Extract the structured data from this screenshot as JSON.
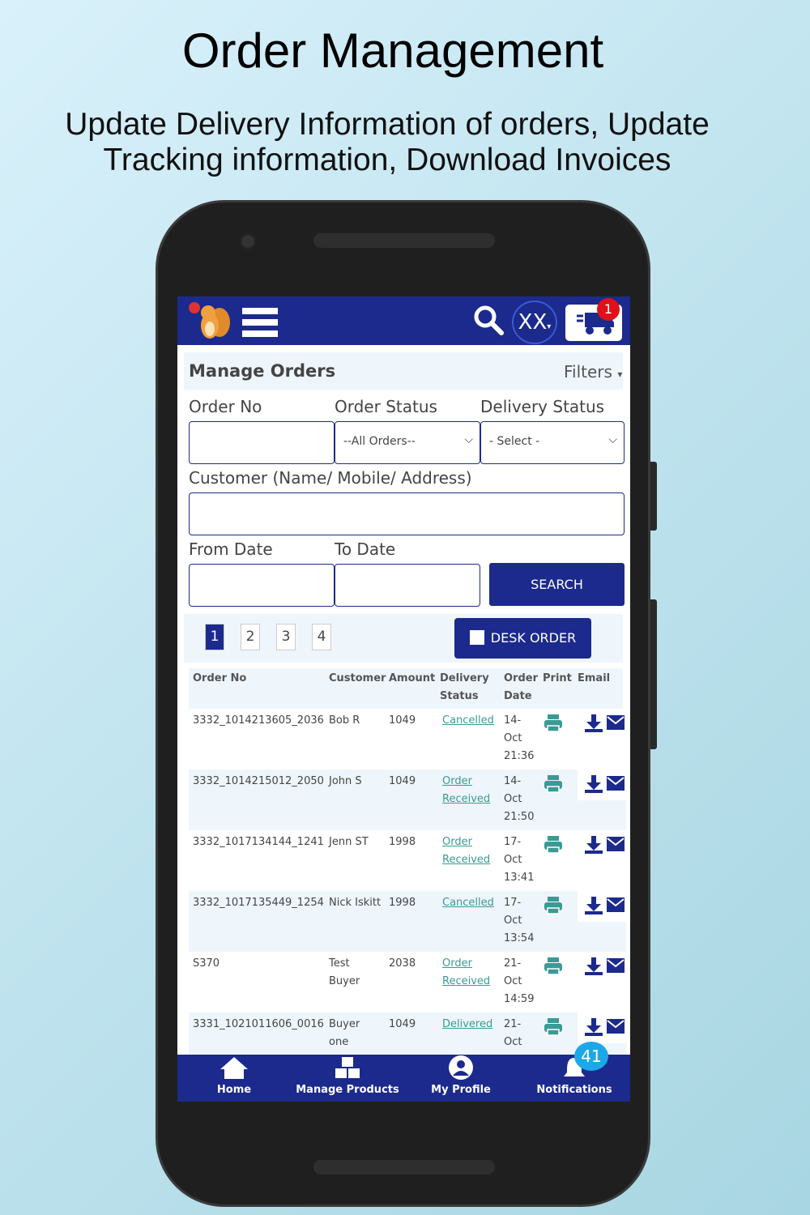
{
  "headline": "Order Management",
  "subtitle_line1": "Update Delivery Information of orders, Update",
  "subtitle_line2": "Tracking information, Download Invoices",
  "app": {
    "user_initials": "XX",
    "cart_badge": "1",
    "page_title": "Manage Orders",
    "filters_label": "Filters",
    "form": {
      "order_no_label": "Order No",
      "order_no_value": "",
      "order_status_label": "Order Status",
      "order_status_value": "--All Orders--",
      "delivery_status_label": "Delivery Status",
      "delivery_status_value": "- Select -",
      "customer_label": "Customer (Name/ Mobile/ Address)",
      "customer_value": "",
      "from_date_label": "From Date",
      "from_date_value": "",
      "to_date_label": "To Date",
      "to_date_value": "",
      "search_button": "SEARCH"
    },
    "pagination": [
      "1",
      "2",
      "3",
      "4"
    ],
    "current_page": "1",
    "desk_order_button": "DESK ORDER",
    "table": {
      "headers": {
        "order_no": "Order No",
        "customer": "Customer",
        "amount": "Amount",
        "delivery_status_1": "Delivery",
        "delivery_status_2": "Status",
        "order_date_1": "Order",
        "order_date_2": "Date",
        "print": "Print",
        "email": "Email"
      },
      "rows": [
        {
          "order_no": "3332_1014213605_2036",
          "customer1": "Bob R",
          "customer2": "",
          "amount": "1049",
          "status1": "Cancelled",
          "status2": "",
          "date1": "14-",
          "date2": "Oct",
          "date3": "21:36"
        },
        {
          "order_no": "3332_1014215012_2050",
          "customer1": "John S",
          "customer2": "",
          "amount": "1049",
          "status1": "Order",
          "status2": "Received",
          "date1": "14-",
          "date2": "Oct",
          "date3": "21:50"
        },
        {
          "order_no": "3332_1017134144_1241",
          "customer1": "Jenn ST",
          "customer2": "",
          "amount": "1998",
          "status1": "Order",
          "status2": "Received",
          "date1": "17-",
          "date2": "Oct",
          "date3": "13:41"
        },
        {
          "order_no": "3332_1017135449_1254",
          "customer1": "Nick Iskitt",
          "customer2": "",
          "amount": "1998",
          "status1": "Cancelled",
          "status2": "",
          "date1": "17-",
          "date2": "Oct",
          "date3": "13:54"
        },
        {
          "order_no": "S370",
          "customer1": "Test",
          "customer2": "Buyer",
          "amount": "2038",
          "status1": "Order",
          "status2": "Received",
          "date1": "21-",
          "date2": "Oct",
          "date3": "14:59"
        },
        {
          "order_no": "3331_1021011606_0016",
          "customer1": "Buyer",
          "customer2": "one",
          "amount": "1049",
          "status1": "Delivered",
          "status2": "",
          "date1": "21-",
          "date2": "Oct",
          "date3": ""
        }
      ]
    },
    "bottom_nav": [
      {
        "label": "Home",
        "icon": "home-icon"
      },
      {
        "label": "Manage Products",
        "icon": "boxes-icon"
      },
      {
        "label": "My Profile",
        "icon": "user-icon"
      },
      {
        "label": "Notifications",
        "icon": "bell-icon"
      }
    ],
    "notifications_badge": "41",
    "colors": {
      "primary": "#1b2a8c",
      "link": "#3a9a94",
      "badge_red": "#e0101a",
      "badge_blue": "#1ea7e8"
    }
  }
}
